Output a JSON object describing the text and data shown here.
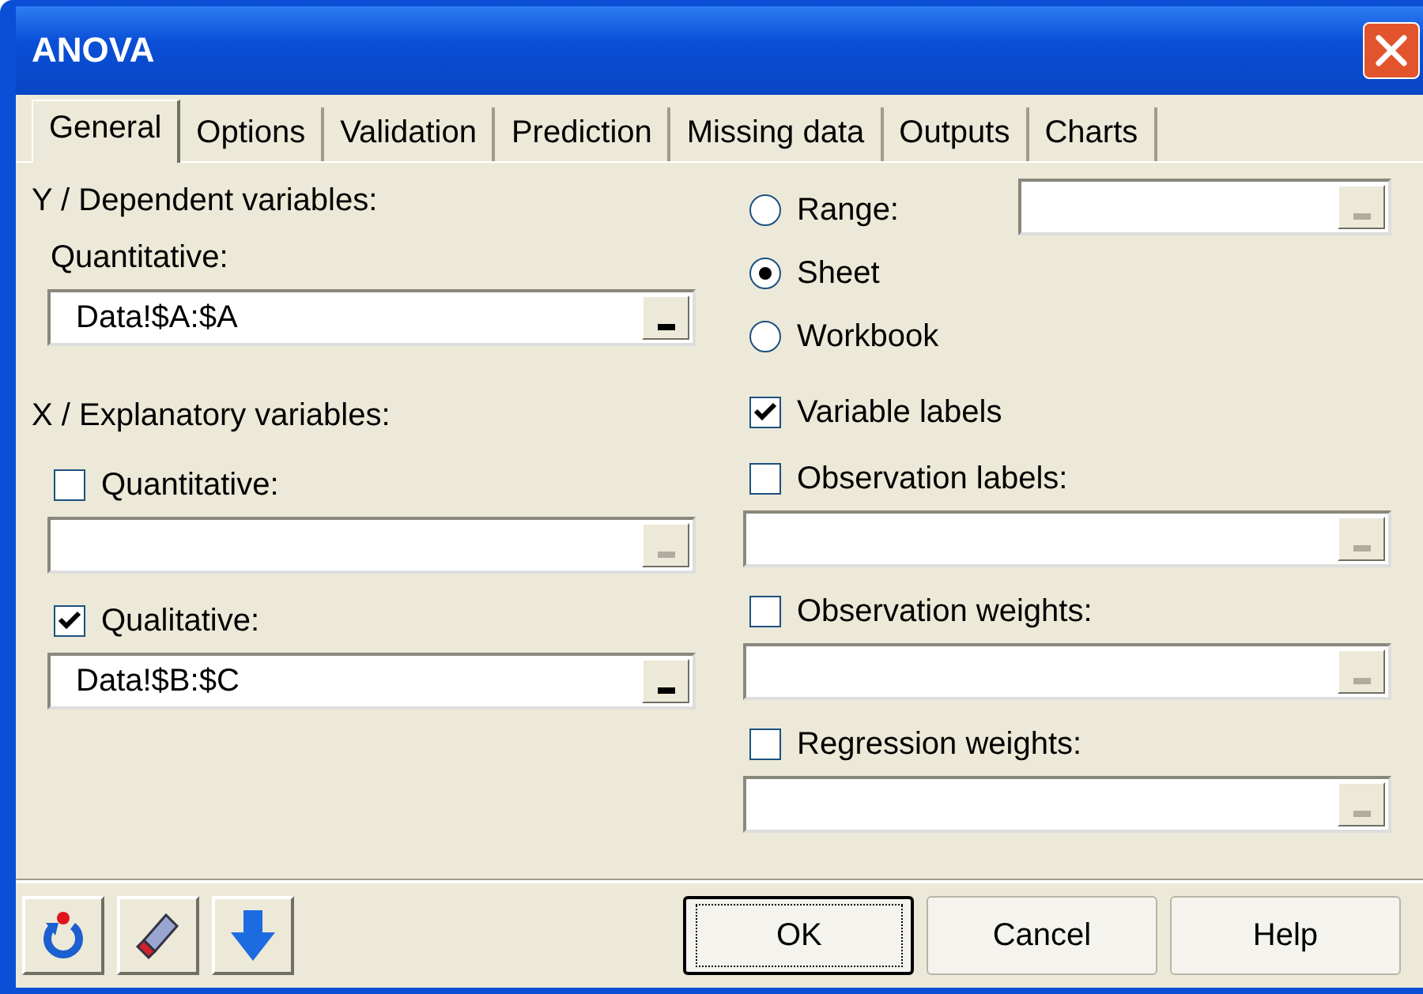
{
  "window": {
    "title": "ANOVA"
  },
  "tabs": [
    {
      "label": "General",
      "selected": true
    },
    {
      "label": "Options",
      "selected": false
    },
    {
      "label": "Validation",
      "selected": false
    },
    {
      "label": "Prediction",
      "selected": false
    },
    {
      "label": "Missing data",
      "selected": false
    },
    {
      "label": "Outputs",
      "selected": false
    },
    {
      "label": "Charts",
      "selected": false
    }
  ],
  "y_section": {
    "label": "Y / Dependent variables:",
    "sub_label": "Quantitative:",
    "field": {
      "value": "Data!$A:$A",
      "disabled": false
    }
  },
  "x_section": {
    "label": "X / Explanatory variables:",
    "groups": [
      {
        "label": "Quantitative:",
        "checked": false,
        "field": {
          "disabled": true
        }
      },
      {
        "label": "Qualitative:",
        "checked": true,
        "field": {
          "value": "Data!$B:$C",
          "disabled": false
        }
      }
    ]
  },
  "output_target": {
    "options": [
      {
        "label": "Range:",
        "selected": false
      },
      {
        "label": "Sheet",
        "selected": true
      },
      {
        "label": "Workbook",
        "selected": false
      }
    ],
    "range_field": {
      "disabled": true
    }
  },
  "options": [
    {
      "label": "Variable labels",
      "checked": true
    },
    {
      "label": "Observation labels:",
      "checked": false,
      "field": {
        "disabled": true
      }
    },
    {
      "label": "Observation weights:",
      "checked": false,
      "field": {
        "disabled": true
      }
    },
    {
      "label": "Regression weights:",
      "checked": false,
      "field": {
        "disabled": true
      }
    }
  ],
  "buttons": [
    {
      "label": "OK",
      "default": true
    },
    {
      "label": "Cancel",
      "default": false
    },
    {
      "label": "Help",
      "default": false
    }
  ]
}
